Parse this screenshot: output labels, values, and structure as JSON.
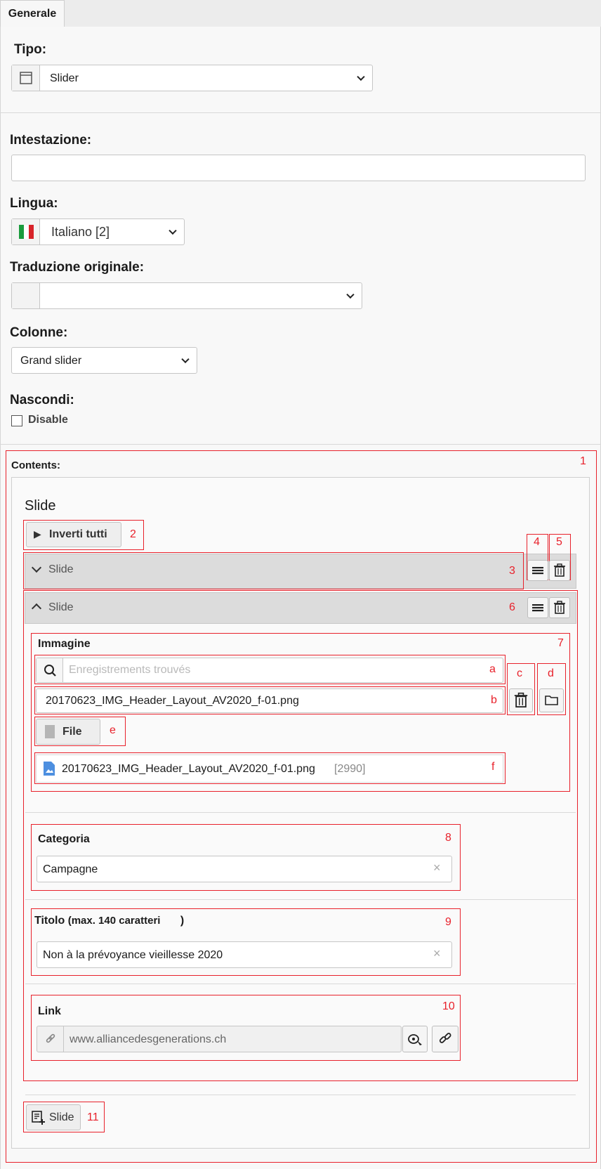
{
  "tabs": [
    {
      "label": "Generale"
    }
  ],
  "form": {
    "tipo": {
      "label": "Tipo:",
      "value": "Slider"
    },
    "intestazione": {
      "label": "Intestazione:",
      "value": ""
    },
    "lingua": {
      "label": "Lingua:",
      "value": "Italiano [2]"
    },
    "traduzione": {
      "label": "Traduzione originale:",
      "value": ""
    },
    "colonne": {
      "label": "Colonne:",
      "value": "Grand slider"
    },
    "nascondi": {
      "label": "Nascondi:",
      "checkbox_label": "Disable",
      "checked": false
    }
  },
  "contents": {
    "label": "Contents:",
    "section_title": "Slide",
    "toggle_all_label": "Inverti tutti",
    "collapsed_item": {
      "title": "Slide"
    },
    "expanded_item": {
      "title": "Slide",
      "image": {
        "label": "Immagine",
        "search_placeholder": "Enregistrements trouvés",
        "selected_file": "20170623_IMG_Header_Layout_AV2020_f-01.png",
        "file_button_label": "File",
        "file_ref_name": "20170623_IMG_Header_Layout_AV2020_f-01.png",
        "file_ref_uid": "[2990]"
      },
      "categoria": {
        "label": "Categoria",
        "value": "Campagne"
      },
      "titolo": {
        "label": "Titolo",
        "hint": "(max. 140 caratteri",
        "hint_close": ")",
        "value": "Non à la prévoyance vieillesse 2020"
      },
      "link": {
        "label": "Link",
        "value": "www.alliancedesgenerations.ch"
      }
    },
    "add_button_label": "Slide"
  },
  "annotations": [
    "1",
    "2",
    "3",
    "4",
    "5",
    "6",
    "7",
    "a",
    "b",
    "c",
    "d",
    "e",
    "f",
    "8",
    "9",
    "10",
    "11"
  ],
  "colors": {
    "annotation": "#e8212b",
    "header_gray": "#dcdcdc",
    "panel_bg": "#f8f8f8"
  }
}
